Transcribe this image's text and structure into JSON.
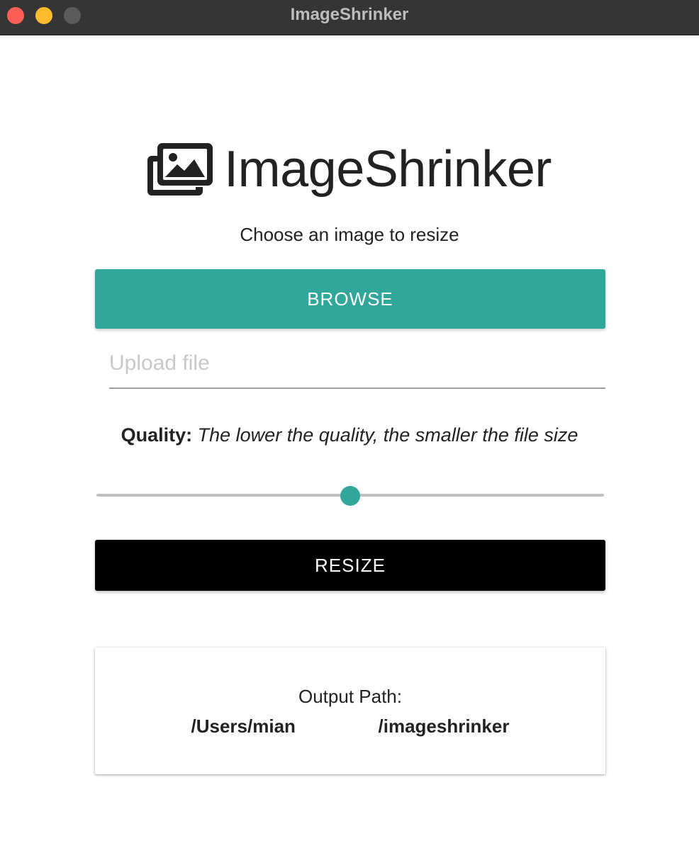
{
  "window": {
    "title": "ImageShrinker"
  },
  "header": {
    "app_name": "ImageShrinker",
    "logo_icon": "images-icon",
    "subtitle": "Choose an image to resize"
  },
  "form": {
    "browse_label": "BROWSE",
    "file_placeholder": "Upload file",
    "file_value": "",
    "quality_label": "Quality:",
    "quality_hint": "The lower the quality, the smaller the file size",
    "quality_fraction": 0.5,
    "resize_label": "RESIZE"
  },
  "output": {
    "label": "Output Path:",
    "path_start": "/Users/mian",
    "path_end": "/imageshrinker"
  },
  "colors": {
    "accent": "#31a69a",
    "resize_button": "#000000",
    "titlebar": "#353535",
    "close": "#fe5f57",
    "minimize": "#febc2e",
    "maximize": "#5b5b5b"
  }
}
